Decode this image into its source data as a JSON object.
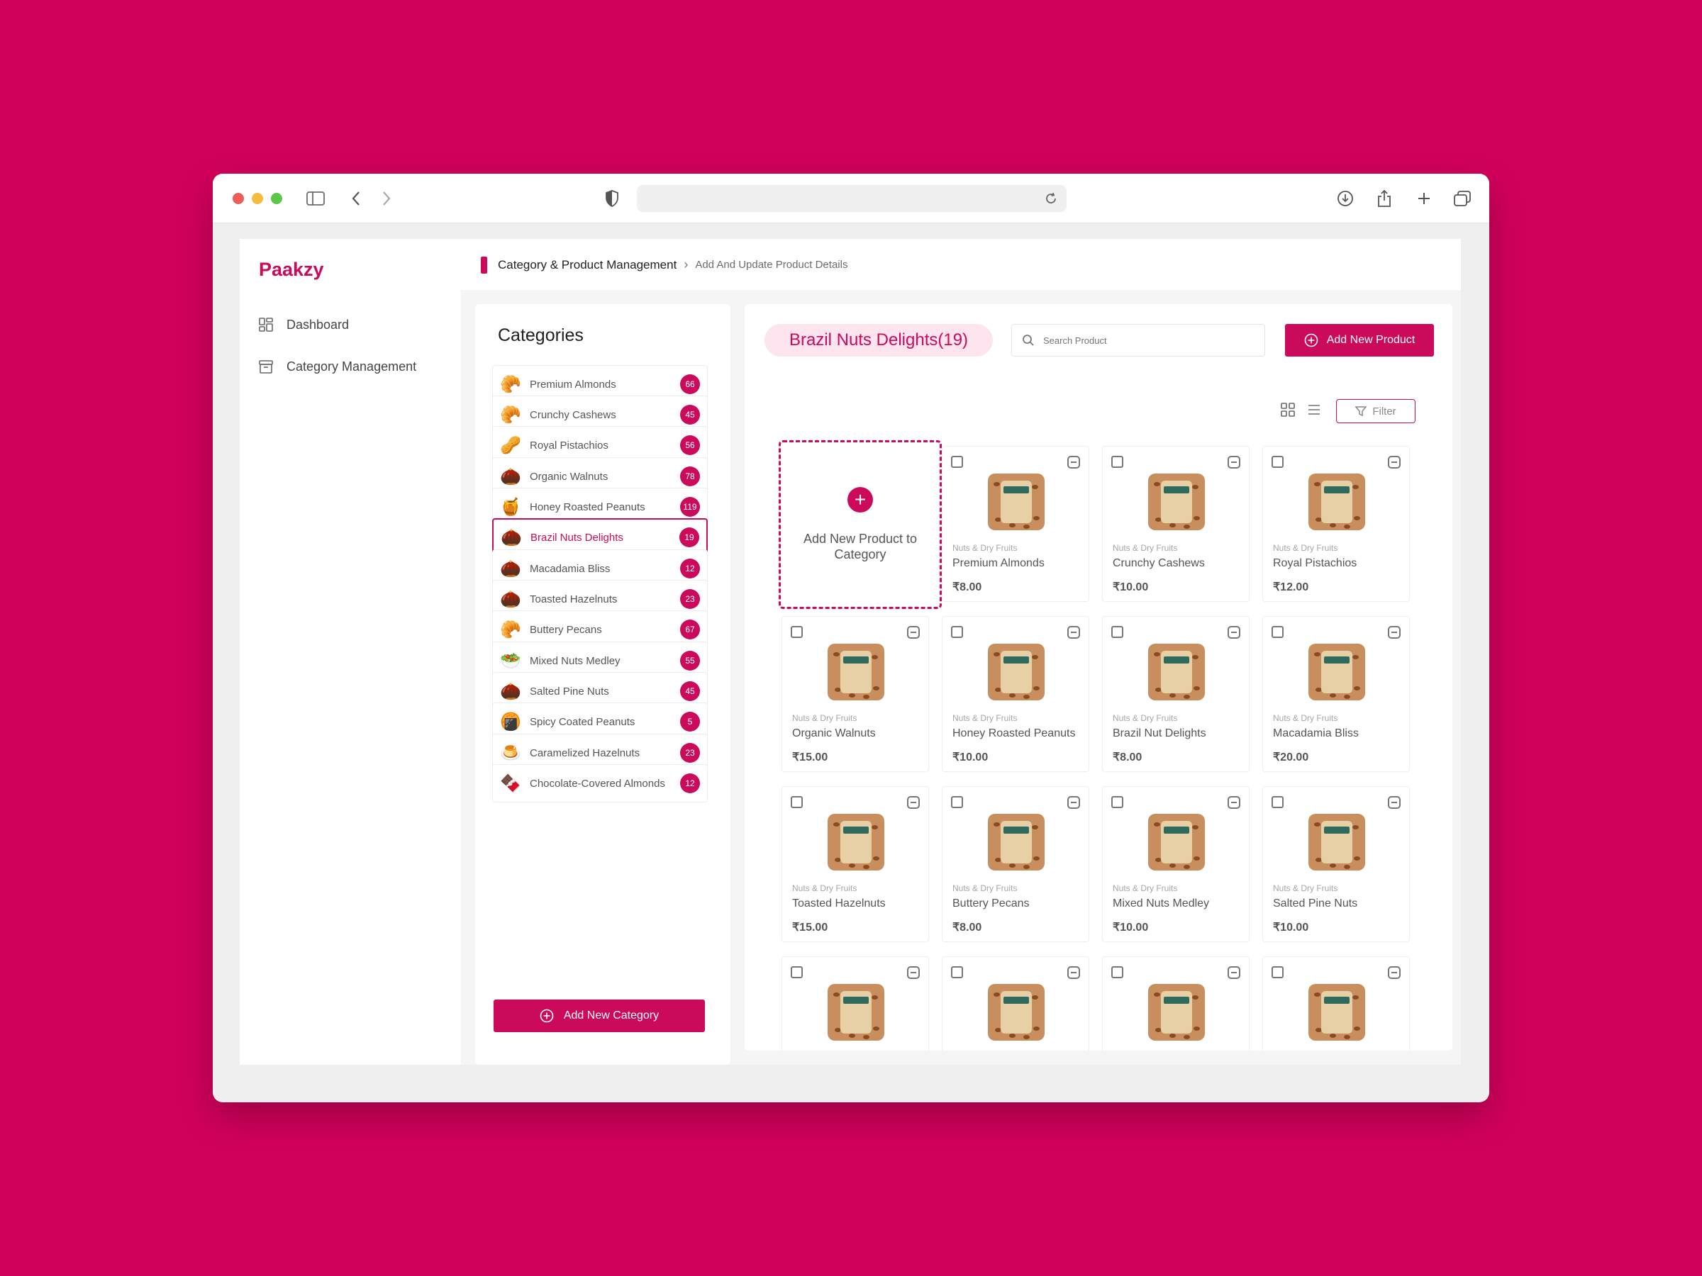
{
  "app": {
    "brand": "Paakzy"
  },
  "sidebar": {
    "items": [
      {
        "label": "Dashboard"
      },
      {
        "label": "Category  Management"
      }
    ]
  },
  "breadcrumb": {
    "section": "Category & Product Management",
    "page": "Add And Update Product Details"
  },
  "categories": {
    "title": "Categories",
    "add_label": "Add New Category",
    "items": [
      {
        "label": "Premium Almonds",
        "count": "66"
      },
      {
        "label": "Crunchy Cashews",
        "count": "45"
      },
      {
        "label": "Royal Pistachios",
        "count": "56"
      },
      {
        "label": "Organic Walnuts",
        "count": "78"
      },
      {
        "label": "Honey Roasted Peanuts",
        "count": "119"
      },
      {
        "label": "Brazil Nuts Delights",
        "count": "19"
      },
      {
        "label": "Macadamia Bliss",
        "count": "12"
      },
      {
        "label": "Toasted Hazelnuts",
        "count": "23"
      },
      {
        "label": "Buttery Pecans",
        "count": "67"
      },
      {
        "label": "Mixed Nuts Medley",
        "count": "55"
      },
      {
        "label": "Salted Pine Nuts",
        "count": "45"
      },
      {
        "label": "Spicy Coated Peanuts",
        "count": "5"
      },
      {
        "label": "Caramelized Hazelnuts",
        "count": "23"
      },
      {
        "label": "Chocolate-Covered Almonds",
        "count": "12"
      }
    ]
  },
  "products": {
    "category_title": "Brazil Nuts Delights(19)",
    "search_placeholder": "Search Product",
    "add_label": "Add New Product",
    "filter_label": "Filter",
    "add_card_label": "Add New Product to Category",
    "items": [
      {
        "category": "Nuts & Dry Fruits",
        "name": "Premium Almonds",
        "price": "₹8.00"
      },
      {
        "category": "Nuts & Dry Fruits",
        "name": "Crunchy Cashews",
        "price": "₹10.00"
      },
      {
        "category": "Nuts & Dry Fruits",
        "name": "Royal Pistachios",
        "price": "₹12.00"
      },
      {
        "category": "Nuts & Dry Fruits",
        "name": "Organic Walnuts",
        "price": "₹15.00"
      },
      {
        "category": "Nuts & Dry Fruits",
        "name": "Honey Roasted Peanuts",
        "price": "₹10.00"
      },
      {
        "category": "Nuts & Dry Fruits",
        "name": "Brazil Nut Delights",
        "price": "₹8.00"
      },
      {
        "category": "Nuts & Dry Fruits",
        "name": "Macadamia Bliss",
        "price": "₹20.00"
      },
      {
        "category": "Nuts & Dry Fruits",
        "name": "Toasted Hazelnuts",
        "price": "₹15.00"
      },
      {
        "category": "Nuts & Dry Fruits",
        "name": "Buttery Pecans",
        "price": "₹8.00"
      },
      {
        "category": "Nuts & Dry Fruits",
        "name": "Mixed Nuts Medley",
        "price": "₹10.00"
      },
      {
        "category": "Nuts & Dry Fruits",
        "name": "Salted Pine Nuts",
        "price": "₹10.00"
      }
    ]
  },
  "colors": {
    "accent": "#CC0A5B",
    "background": "#D1005B"
  }
}
